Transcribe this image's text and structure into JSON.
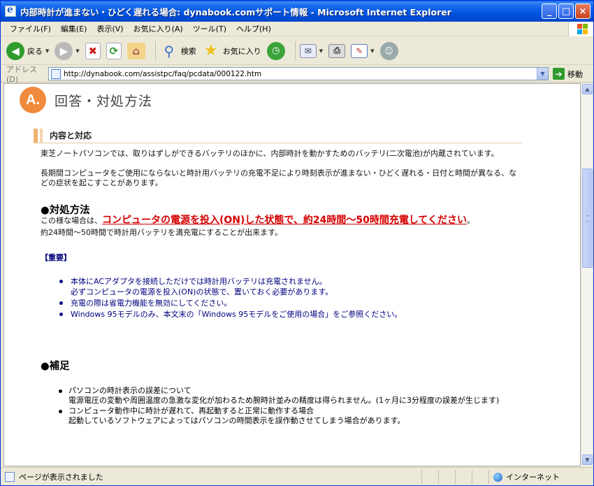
{
  "window": {
    "title": "内部時計が進まない・ひどく遅れる場合: dynabook.comサポート情報 - Microsoft Internet Explorer",
    "minimize": "_",
    "maximize": "□",
    "close": "×"
  },
  "menu": [
    "ファイル(F)",
    "編集(E)",
    "表示(V)",
    "お気に入り(A)",
    "ツール(T)",
    "ヘルプ(H)"
  ],
  "toolbar": {
    "back_label": "戻る",
    "search_label": "検索",
    "favorites_label": "お気に入り"
  },
  "address": {
    "label": "アドレス(D)",
    "url": "http://dynabook.com/assistpc/faq/pcdata/000122.htm",
    "go_label": "移動"
  },
  "content": {
    "badge": "A.",
    "answer_title": "回答・対処方法",
    "section_title": "内容と対応",
    "intro": [
      "東芝ノートパソコンでは、取りはずしができるバッテリのほかに、内部時計を動かすためのバッテリ(二次電池)が内蔵されています。",
      "長期間コンピュータをご使用にならないと時計用バッテリの充電不足により時刻表示が進まない・ひどく遅れる・日付と時間が異なる、などの症状を起こすことがあります。"
    ],
    "remedy_heading": "●対処方法",
    "remedy_prefix": "この様な場合は、",
    "remedy_link": "コンピュータの電源を投入(ON)した状態で、約24時間〜50時間充電してください",
    "remedy_suffix": "。",
    "remedy_note": "約24時間〜50時間で時計用バッテリを満充電にすることが出来ます。",
    "important_label": "【重要】",
    "important_items": [
      [
        "本体にACアダプタを接続しただけでは時計用バッテリは充電されません。",
        "必ずコンピュータの電源を投入(ON)の状態で、置いておく必要があります。"
      ],
      [
        "充電の際は省電力機能を無効にしてください。"
      ],
      [
        "Windows 95モデルのみ、本文末の「Windows 95モデルをご使用の場合」をご参照ください。"
      ]
    ],
    "supplement_heading": "●補足",
    "supplement_items": [
      [
        "パソコンの時計表示の誤差について",
        "電源電圧の変動や周囲温度の急激な変化が加わるため腕時計並みの精度は得られません。(1ヶ月に3分程度の誤差が生じます)"
      ],
      [
        "コンピュータ動作中に時計が遅れて、再起動すると正常に動作する場合",
        "起動しているソフトウェアによってはパソコンの時間表示を誤作動させてしまう場合があります。"
      ]
    ]
  },
  "status": {
    "text": "ページが表示されました",
    "zone": "インターネット"
  }
}
